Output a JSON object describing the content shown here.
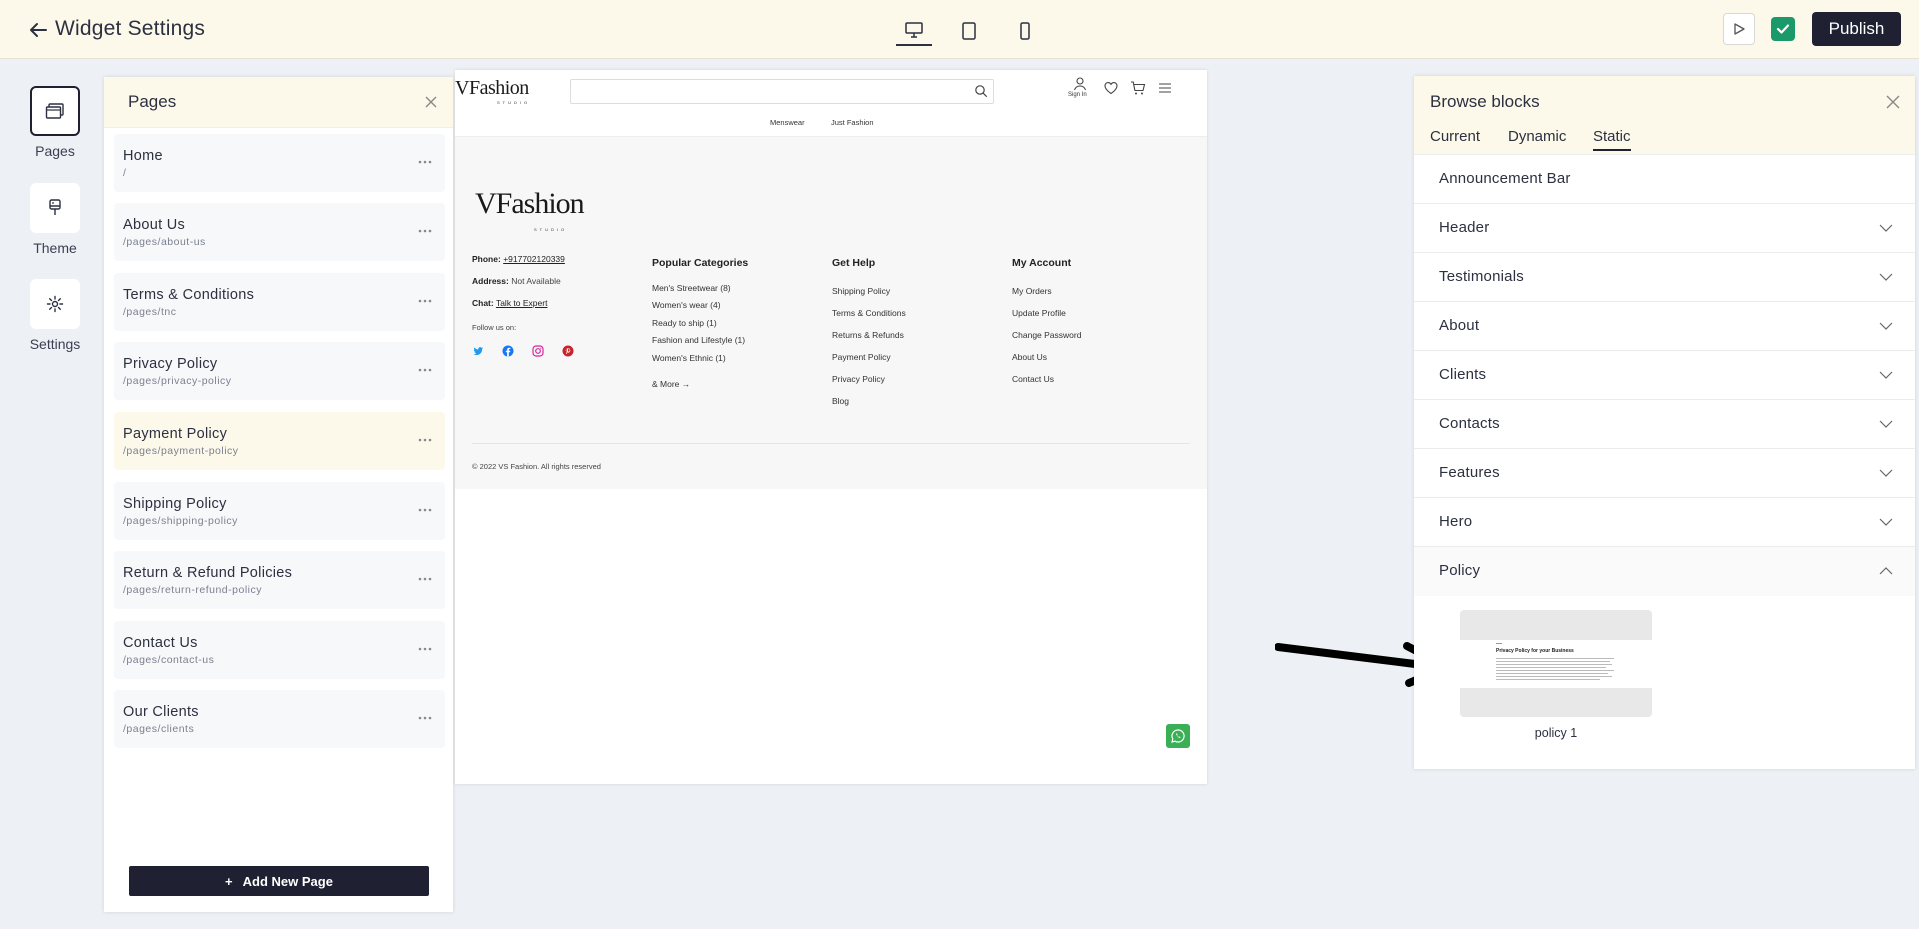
{
  "header": {
    "title": "Widget Settings",
    "publish_label": "Publish",
    "devices": [
      "desktop",
      "tablet",
      "mobile"
    ],
    "active_device": "desktop"
  },
  "rail": [
    {
      "label": "Pages",
      "icon": "pages-icon",
      "active": true
    },
    {
      "label": "Theme",
      "icon": "brush-icon",
      "active": false
    },
    {
      "label": "Settings",
      "icon": "gear-icon",
      "active": false
    }
  ],
  "pages_panel": {
    "title": "Pages",
    "items": [
      {
        "name": "Home",
        "path": "/"
      },
      {
        "name": "About Us",
        "path": "/pages/about-us"
      },
      {
        "name": "Terms & Conditions",
        "path": "/pages/tnc"
      },
      {
        "name": "Privacy Policy",
        "path": "/pages/privacy-policy"
      },
      {
        "name": "Payment Policy",
        "path": "/pages/payment-policy",
        "highlighted": true
      },
      {
        "name": "Shipping Policy",
        "path": "/pages/shipping-policy"
      },
      {
        "name": "Return & Refund Policies",
        "path": "/pages/return-refund-policy"
      },
      {
        "name": "Contact Us",
        "path": "/pages/contact-us"
      },
      {
        "name": "Our Clients",
        "path": "/pages/clients"
      }
    ],
    "add_label": "Add New Page"
  },
  "preview": {
    "logo": "VFashion",
    "logo_sub": "STUDIO",
    "signin": "Sign In",
    "nav": [
      "Menswear",
      "Just Fashion"
    ],
    "footer": {
      "logo": "VFashion",
      "logo_sub": "STUDIO",
      "phone_label": "Phone:",
      "phone": "+917702120339",
      "address_label": "Address:",
      "address": "Not Available",
      "chat_label": "Chat:",
      "chat": "Talk to Expert",
      "follow": "Follow us on:",
      "columns": [
        {
          "heading": "Popular Categories",
          "links": [
            "Men's Streetwear (8)",
            "Women's wear (4)",
            "Ready to ship (1)",
            "Fashion and Lifestyle (1)",
            "Women's Ethnic (1)"
          ],
          "more": "& More"
        },
        {
          "heading": "Get Help",
          "links": [
            "Shipping Policy",
            "Terms & Conditions",
            "Returns & Refunds",
            "Payment Policy",
            "Privacy Policy",
            "Blog"
          ]
        },
        {
          "heading": "My Account",
          "links": [
            "My Orders",
            "Update Profile",
            "Change Password",
            "About Us",
            "Contact Us"
          ]
        }
      ],
      "copyright": "© 2022 VS Fashion. All rights reserved"
    }
  },
  "browse": {
    "title": "Browse blocks",
    "tabs": [
      "Current",
      "Dynamic",
      "Static"
    ],
    "active_tab": "Static",
    "items": [
      {
        "label": "Announcement Bar",
        "expandable": false
      },
      {
        "label": "Header",
        "expandable": true
      },
      {
        "label": "Testimonials",
        "expandable": true
      },
      {
        "label": "About",
        "expandable": true
      },
      {
        "label": "Clients",
        "expandable": true
      },
      {
        "label": "Contacts",
        "expandable": true
      },
      {
        "label": "Features",
        "expandable": true
      },
      {
        "label": "Hero",
        "expandable": true
      },
      {
        "label": "Policy",
        "expandable": true,
        "expanded": true
      }
    ],
    "policy_thumb_label": "policy 1",
    "policy_thumb_heading": "Privacy Policy for your Business"
  },
  "colors": {
    "accent": "#1f2133",
    "header_bg": "#fdf9ea",
    "success": "#1a9a6b",
    "whatsapp": "#3aaf55"
  }
}
